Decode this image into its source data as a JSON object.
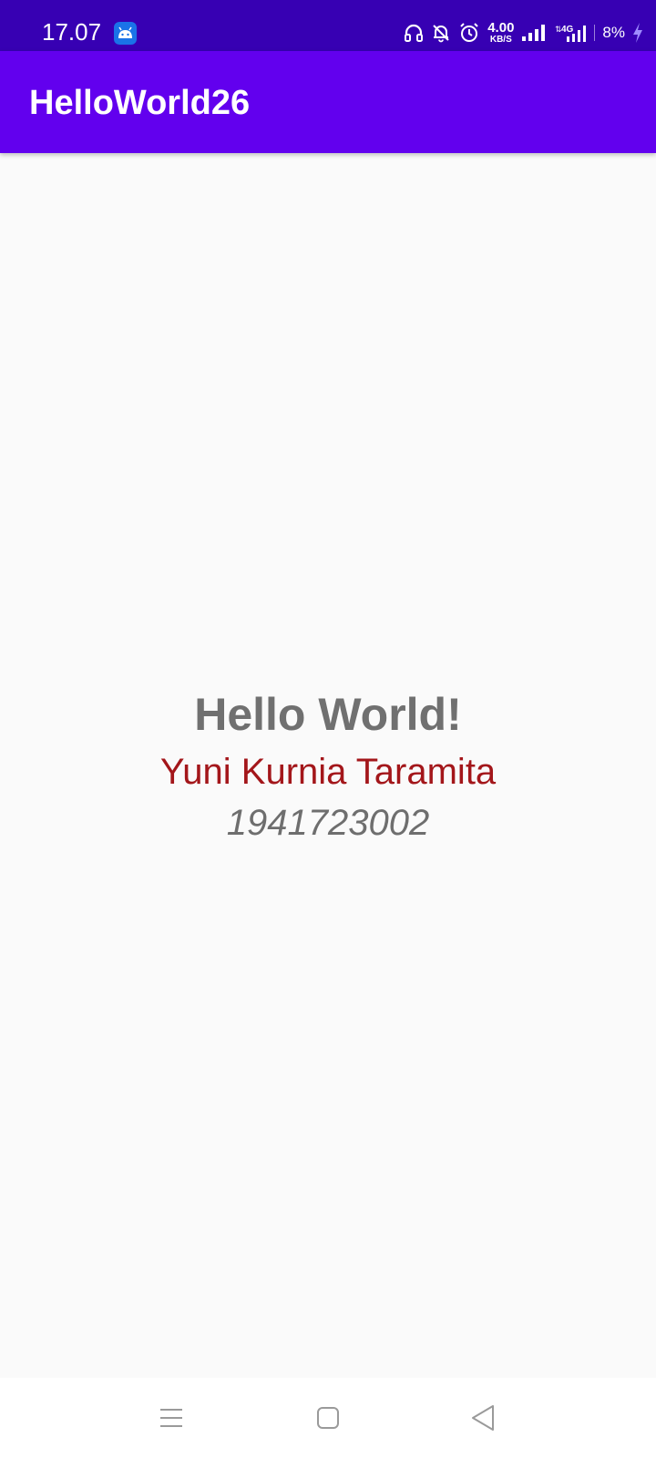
{
  "status_bar": {
    "time": "17.07",
    "speed_value": "4.00",
    "speed_unit": "KB/S",
    "network_type": "4G",
    "battery_percent": "8%",
    "icons": [
      "android-notification-icon",
      "headphones-icon",
      "bell-off-icon",
      "alarm-icon",
      "signal-icon",
      "4g-signal-icon",
      "charging-icon"
    ]
  },
  "app_bar": {
    "title": "HelloWorld26"
  },
  "main": {
    "greeting": "Hello World!",
    "name": "Yuni Kurnia Taramita",
    "student_id": "1941723002"
  },
  "nav_bar": {
    "buttons": [
      "menu-icon",
      "home-icon",
      "back-icon"
    ]
  },
  "colors": {
    "status_bar": "#3700b3",
    "app_bar": "#6200ee",
    "background": "#fafafa",
    "greeting": "#707070",
    "name": "#a3161a",
    "student_id": "#6e6e6e"
  }
}
